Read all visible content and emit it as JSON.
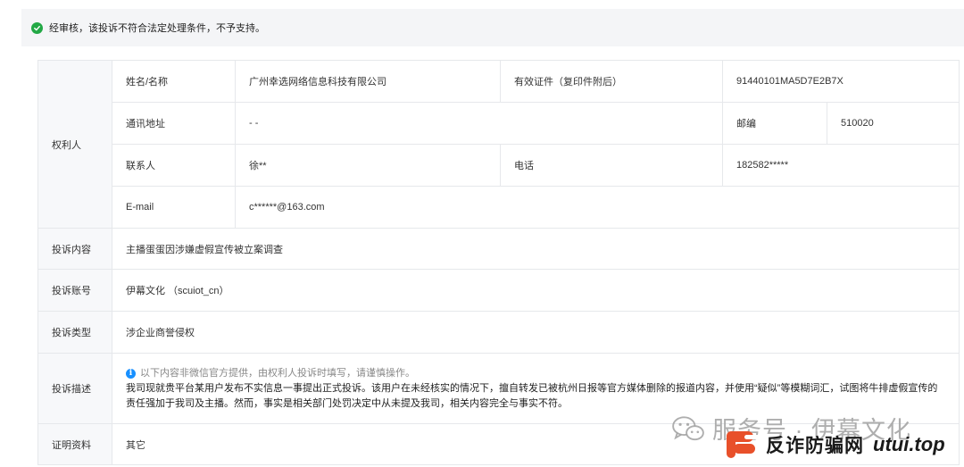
{
  "banner": {
    "text": "经审核，该投诉不符合法定处理条件，不予支持。",
    "icon": "check-circle-icon",
    "icon_color": "#22a845"
  },
  "rights_holder": {
    "section_label": "权利人",
    "name_label": "姓名/名称",
    "name_value": "广州幸选网络信息科技有限公司",
    "cert_label": "有效证件（复印件附后）",
    "cert_value": "91440101MA5D7E2B7X",
    "address_label": "通讯地址",
    "address_value": "- -",
    "zip_label": "邮编",
    "zip_value": "510020",
    "contact_label": "联系人",
    "contact_value": "徐**",
    "phone_label": "电话",
    "phone_value": "182582*****",
    "email_label": "E-mail",
    "email_value": "c******@163.com"
  },
  "complaint": {
    "content_label": "投诉内容",
    "content_value": "主播蛋蛋因涉嫌虚假宣传被立案调查",
    "account_label": "投诉账号",
    "account_value": "伊幕文化 （scuiot_cn）",
    "type_label": "投诉类型",
    "type_value": "涉企业商誉侵权",
    "desc_label": "投诉描述",
    "desc_notice": "以下内容非微信官方提供，由权利人投诉时填写，请谨慎操作。",
    "desc_text": "我司现就贵平台某用户发布不实信息一事提出正式投诉。该用户在未经核实的情况下，擅自转发已被杭州日报等官方媒体删除的报道内容，并使用“疑似”等模糊词汇，试图将牛排虚假宣传的责任强加于我司及主播。然而，事实是相关部门处罚决定中从未提及我司，相关内容完全与事实不符。",
    "evidence_label": "证明资料",
    "evidence_value": "其它"
  },
  "watermark": {
    "line1": "服务号 · 伊幕文化",
    "brand": "反诈防骗网",
    "domain": "utui.top",
    "brand_color": "#e8502a"
  }
}
